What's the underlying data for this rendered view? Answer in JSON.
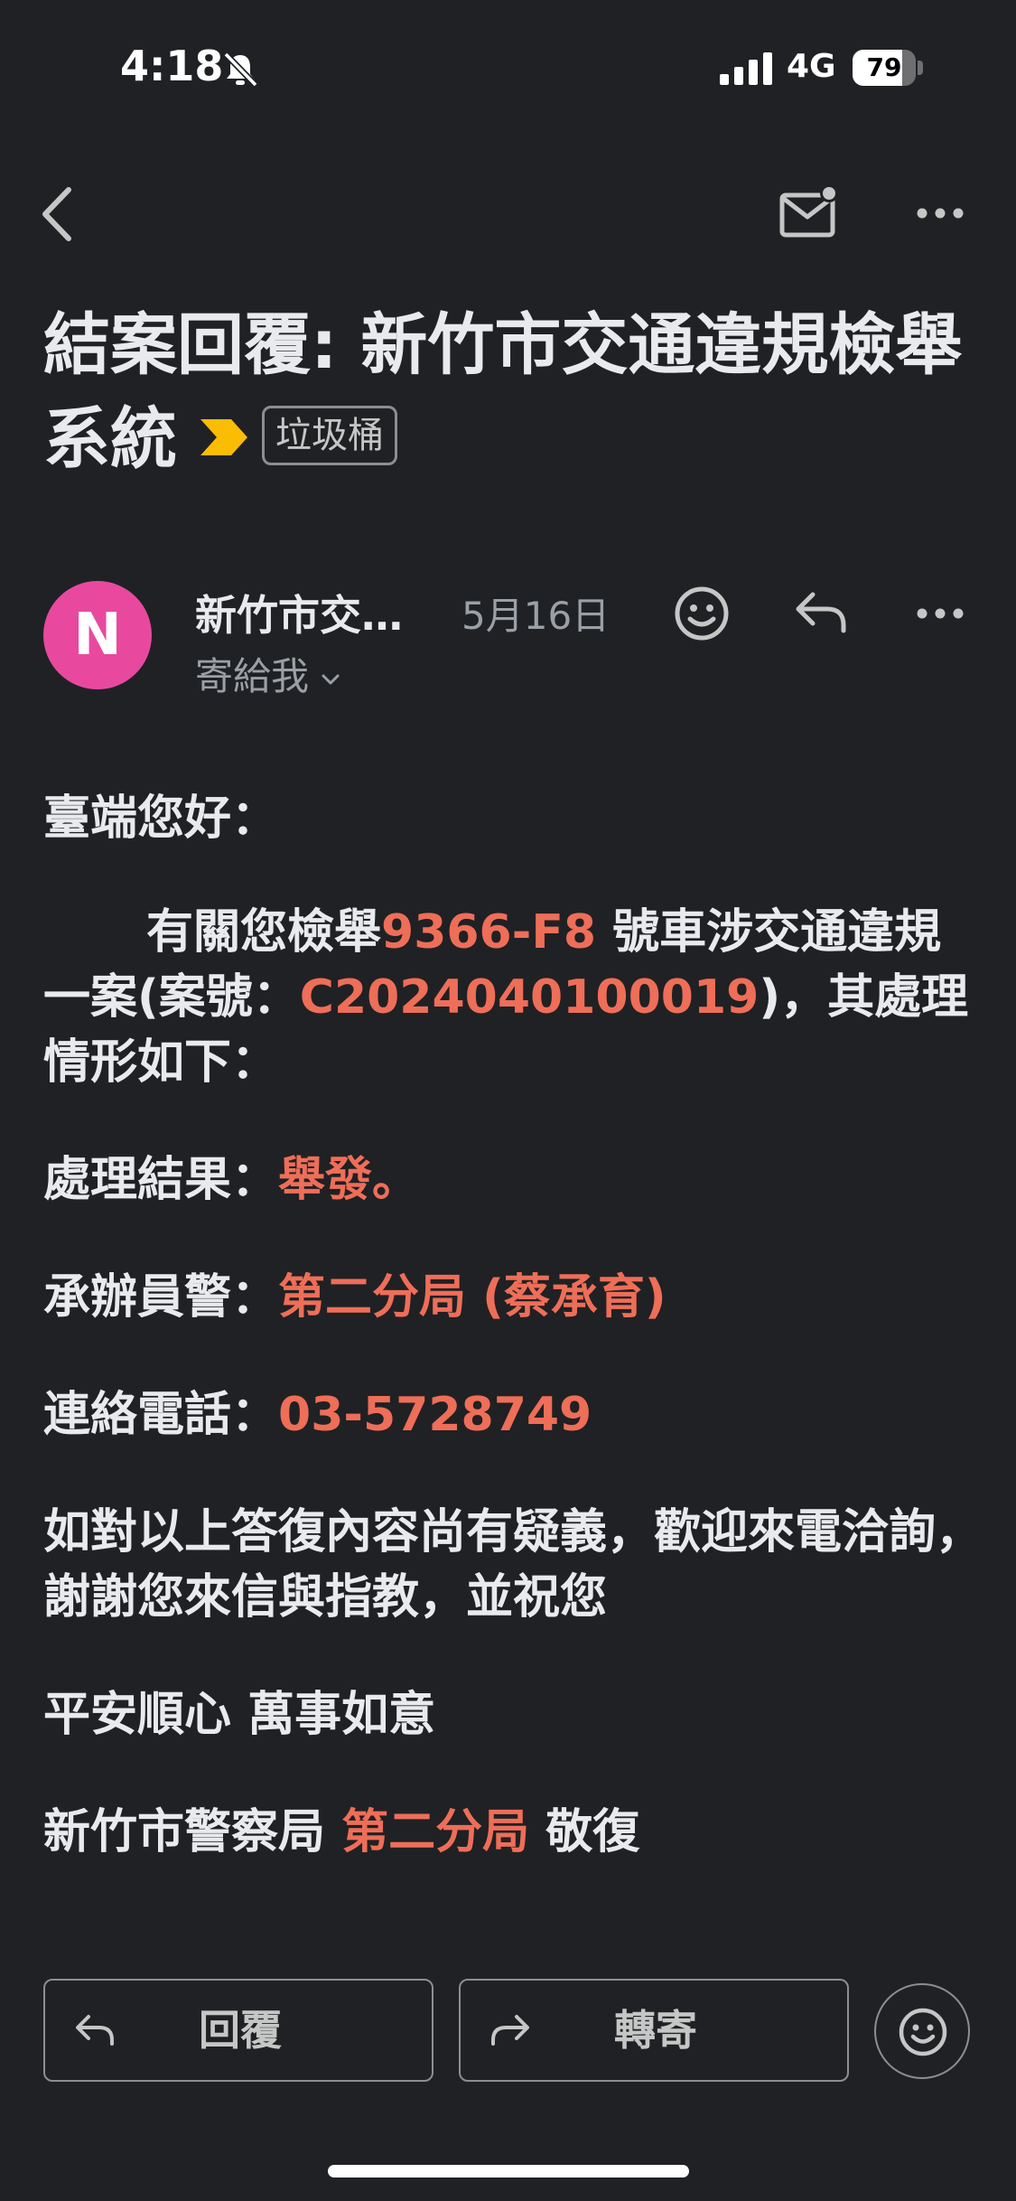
{
  "status_bar": {
    "time": "4:18",
    "network": "4G",
    "battery_level": "79",
    "battery_fraction": 0.79
  },
  "app_bar": {
    "back_icon": "back-arrow-icon",
    "mail_icon": "mark-unread-icon",
    "more_icon": "more-horizontal-icon"
  },
  "subject": {
    "title": "結案回覆: 新竹市交通違規檢舉系統",
    "label": "垃圾桶",
    "importance_color": "#fbbc04"
  },
  "sender": {
    "avatar_letter": "N",
    "avatar_color": "#e8499f",
    "name": "新竹市交…",
    "date": "5月16日",
    "recipient": "寄給我"
  },
  "body": {
    "greeting": "臺端您好：",
    "intro_prefix": "有關您檢舉",
    "plate": "9366-F8",
    "intro_middle": " 號車涉交通違規一案(案號：",
    "case_number": "C2024040100019",
    "intro_suffix": ")，其處理情形如下：",
    "result_label": "處理結果：",
    "result_value": "舉發。",
    "officer_label": "承辦員警：",
    "officer_value": "第二分局 (蔡承育)",
    "phone_label": "連絡電話：",
    "phone_value": "03-5728749",
    "closing": "如對以上答復內容尚有疑義，歡迎來電洽詢，謝謝您來信與指教，並祝您",
    "wish": "平安順心 萬事如意",
    "sign_prefix": "新竹市警察局 ",
    "sign_dept": "第二分局",
    "sign_suffix": " 敬復",
    "highlight_color": "#ee6e58"
  },
  "actions": {
    "reply": "回覆",
    "forward": "轉寄"
  }
}
